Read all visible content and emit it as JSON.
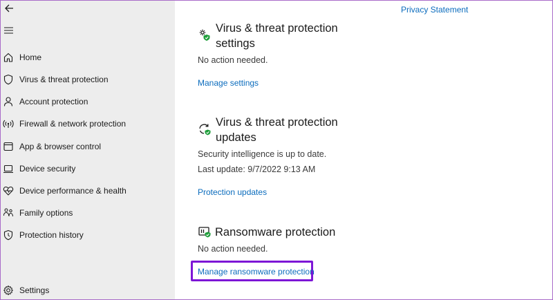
{
  "sidebar": {
    "items": [
      {
        "label": "Home",
        "icon": "home-icon"
      },
      {
        "label": "Virus & threat protection",
        "icon": "shield-icon"
      },
      {
        "label": "Account protection",
        "icon": "person-icon"
      },
      {
        "label": "Firewall & network protection",
        "icon": "wifi-antenna-icon"
      },
      {
        "label": "App & browser control",
        "icon": "app-window-icon"
      },
      {
        "label": "Device security",
        "icon": "laptop-icon"
      },
      {
        "label": "Device performance & health",
        "icon": "heart-pulse-icon"
      },
      {
        "label": "Family options",
        "icon": "family-icon"
      },
      {
        "label": "Protection history",
        "icon": "history-icon"
      }
    ],
    "settings_label": "Settings"
  },
  "main": {
    "privacy_link": "Privacy Statement",
    "sections": [
      {
        "title": "Virus & threat protection settings",
        "icon": "settings-gear-check-icon",
        "lines": [
          "No action needed."
        ],
        "link": "Manage settings"
      },
      {
        "title": "Virus & threat protection updates",
        "icon": "refresh-check-icon",
        "lines": [
          "Security intelligence is up to date.",
          "Last update: 9/7/2022 9:13 AM"
        ],
        "link": "Protection updates"
      },
      {
        "title": "Ransomware protection",
        "icon": "ransomware-folder-icon",
        "lines": [
          "No action needed."
        ],
        "link": "Manage ransomware protection",
        "highlighted": true
      }
    ]
  },
  "colors": {
    "link": "#0b6cbd",
    "sidebar_bg": "#ededed",
    "highlight": "#7d16d6",
    "status_ok": "#1e9e3a"
  }
}
